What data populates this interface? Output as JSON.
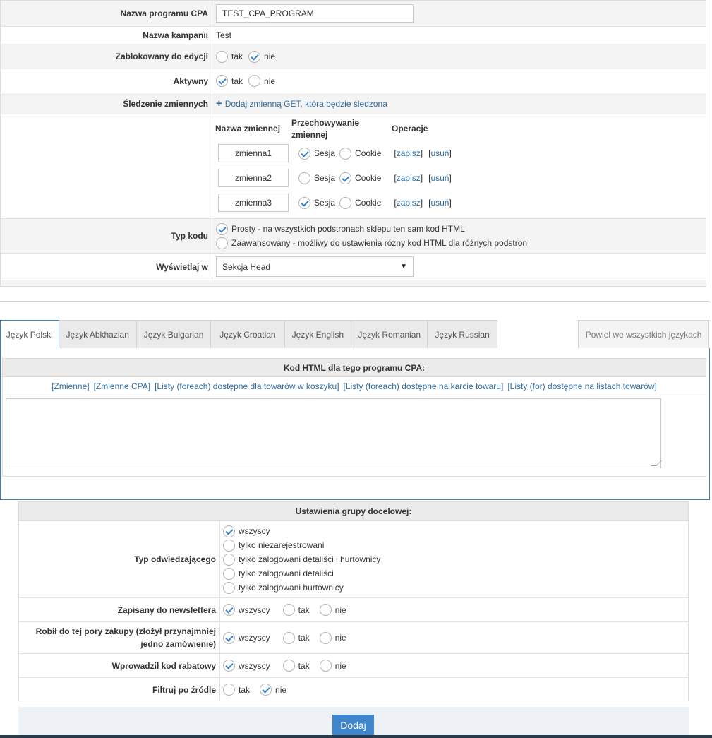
{
  "form": {
    "program_name_label": "Nazwa programu CPA",
    "program_name_value": "TEST_CPA_PROGRAM",
    "campaign_label": "Nazwa kampanii",
    "campaign_value": "Test",
    "locked_label": "Zablokowany do edycji",
    "active_label": "Aktywny",
    "yes": "tak",
    "no": "nie",
    "tracking_label": "Śledzenie zmiennych",
    "add_variable_link": "Dodaj zmienną GET, która będzie śledzona",
    "var_col_name": "Nazwa zmiennej",
    "var_col_storage": "Przechowywanie zmiennej",
    "var_col_ops": "Operacje",
    "session": "Sesja",
    "cookie": "Cookie",
    "save": "zapisz",
    "delete": "usuń",
    "variables": [
      {
        "name": "zmienna1",
        "storage": "Sesja"
      },
      {
        "name": "zmienna2",
        "storage": "Cookie"
      },
      {
        "name": "zmienna3",
        "storage": "Sesja"
      }
    ],
    "code_type_label": "Typ kodu",
    "code_simple": "Prosty - na wszystkich podstronach sklepu ten sam kod HTML",
    "code_advanced": "Zaawansowany - możliwy do ustawienia różny kod HTML dla różnych podstron",
    "display_label": "Wyświetlaj w",
    "display_value": "Sekcja Head"
  },
  "tabs": {
    "items": [
      "Język Polski",
      "Język Abkhazian",
      "Język Bulgarian",
      "Język Croatian",
      "Język English",
      "Język Romanian",
      "Język Russian"
    ],
    "repeat": "Powiel we wszystkich językach"
  },
  "editor": {
    "title": "Kod HTML dla tego programu CPA:",
    "links": [
      "[Zmienne]",
      "[Zmienne CPA]",
      "[Listy (foreach) dostępne dla towarów w koszyku]",
      "[Listy (foreach) dostępne na karcie towaru]",
      "[Listy (for) dostępne na listach towarów]"
    ]
  },
  "target": {
    "title": "Ustawienia grupy docelowej:",
    "visitor_label": "Typ odwiedzającego",
    "visitor_options": [
      "wszyscy",
      "tylko niezarejestrowani",
      "tylko zalogowani detaliści i hurtownicy",
      "tylko zalogowani detaliści",
      "tylko zalogowani hurtownicy"
    ],
    "newsletter_label": "Zapisany do newslettera",
    "purchased_label": "Robił do tej pory zakupy (złożył przynajmniej jedno zamówienie)",
    "coupon_label": "Wprowadził kod rabatowy",
    "source_label": "Filtruj po źródle",
    "all": "wszyscy",
    "yes": "tak",
    "no": "nie"
  },
  "actions": {
    "add": "Dodaj"
  },
  "colors": {
    "accent": "#3a7fcb",
    "button": "#3f86cc"
  }
}
